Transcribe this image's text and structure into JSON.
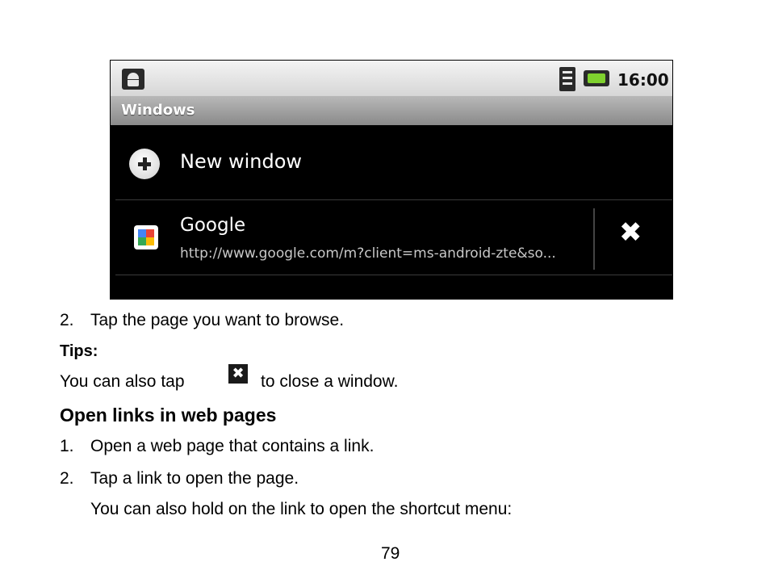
{
  "screenshot": {
    "status_bar": {
      "time": "16:00",
      "icons": [
        "android-icon",
        "wifi-icon",
        "battery-icon"
      ]
    },
    "title": "Windows",
    "rows": [
      {
        "icon": "plus-icon",
        "label": "New window"
      },
      {
        "icon": "google-icon",
        "title": "Google",
        "url": "http://www.google.com/m?client=ms-android-zte&so...",
        "action_icon": "close-icon"
      }
    ],
    "colors": {
      "background": "#000000",
      "title_bar": "#9e9e9e",
      "text": "#ffffff",
      "url_text": "#c8c8c8"
    }
  },
  "doc": {
    "step2_num": "2.",
    "step2_text": "Tap the page you want to browse.",
    "tips_label": "Tips:",
    "tip_before": "You can also tap",
    "tip_after": "to close a window.",
    "section_heading": "Open links in web pages",
    "steps": [
      {
        "num": "1.",
        "text": "Open a web page that contains a link."
      },
      {
        "num": "2.",
        "text": "Tap a link to open the page."
      }
    ],
    "step_note": "You can also hold on the link to open the shortcut menu:",
    "page_number": "79"
  }
}
